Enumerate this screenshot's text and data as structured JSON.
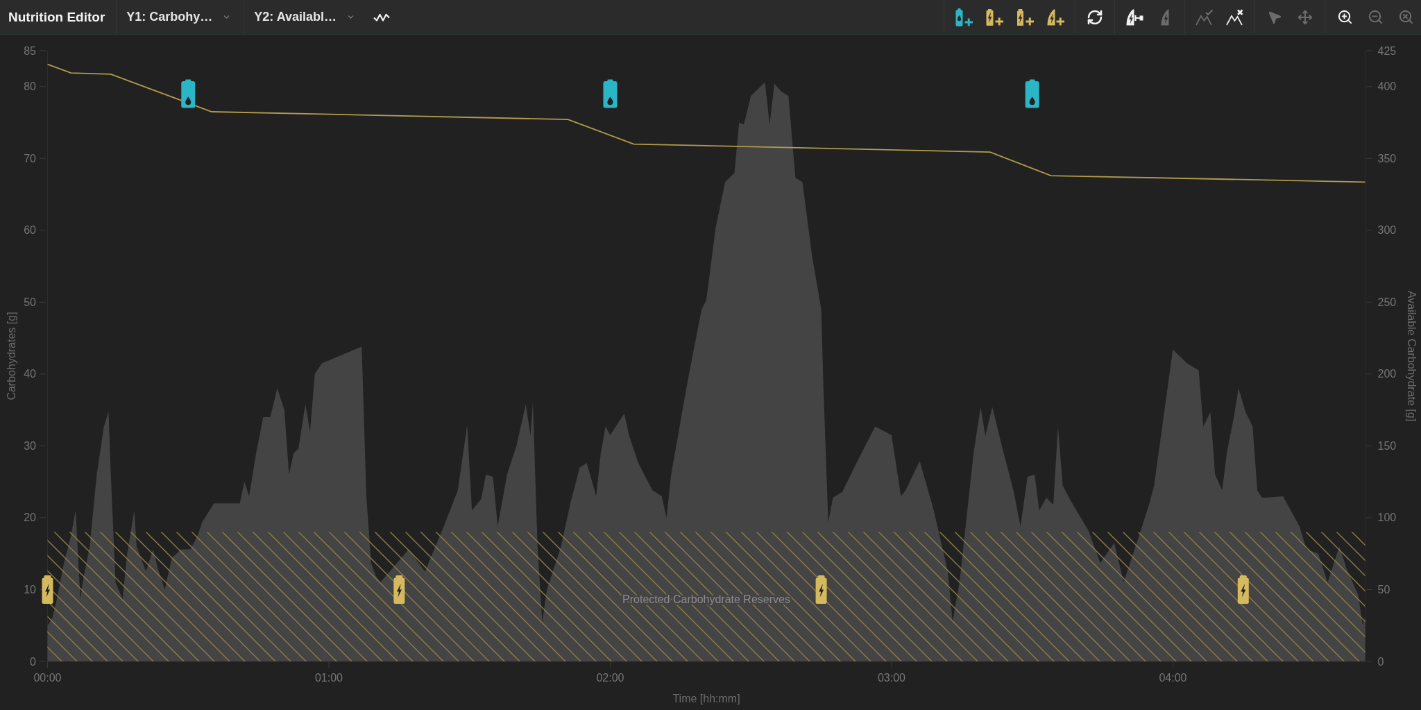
{
  "toolbar": {
    "title": "Nutrition Editor",
    "axis_dropdowns": [
      {
        "label": "Y1: Carbohy…"
      },
      {
        "label": "Y2: Availabl…"
      }
    ],
    "view_tools": [
      {
        "kind": "zigzag",
        "disabled": false
      }
    ],
    "tool_groups": [
      {
        "tools": [
          {
            "kind": "bottle-add",
            "disabled": false
          },
          {
            "kind": "battery-add",
            "disabled": false
          },
          {
            "kind": "pack-add",
            "disabled": false
          },
          {
            "kind": "wedge-add",
            "disabled": false
          }
        ]
      },
      {
        "tools": [
          {
            "kind": "refresh",
            "disabled": false
          }
        ]
      },
      {
        "tools": [
          {
            "kind": "wedge-range",
            "disabled": false
          },
          {
            "kind": "wedge",
            "disabled": true
          }
        ]
      },
      {
        "tools": [
          {
            "kind": "peaks-check",
            "disabled": true
          },
          {
            "kind": "peaks-x",
            "disabled": false
          }
        ]
      },
      {
        "tools": [
          {
            "kind": "pointer",
            "disabled": true
          },
          {
            "kind": "move",
            "disabled": true
          }
        ]
      },
      {
        "tools": [
          {
            "kind": "zoom-in",
            "disabled": false
          },
          {
            "kind": "zoom-out",
            "disabled": true
          },
          {
            "kind": "zoom-reset",
            "disabled": true
          }
        ]
      }
    ]
  },
  "chart": {
    "point_glyphs": [
      {
        "droplet": true
      },
      {
        "droplet": false
      }
    ],
    "chart_data": {
      "type": "area",
      "xlabel": "Time [hh:mm]",
      "ylabel": "Carbohydrates [g]",
      "y2label": "Available Carbohydrate [g]",
      "xlim": [
        0,
        281
      ],
      "ylim": [
        0,
        85
      ],
      "y2lim": [
        0,
        425
      ],
      "xticks": [
        {
          "value": 0,
          "label": "00:00"
        },
        {
          "value": 60,
          "label": "01:00"
        },
        {
          "value": 120,
          "label": "02:00"
        },
        {
          "value": 180,
          "label": "03:00"
        },
        {
          "value": 240,
          "label": "04:00"
        }
      ],
      "yticks": [
        0,
        10,
        20,
        30,
        40,
        50,
        60,
        70,
        80,
        85
      ],
      "y2ticks": [
        0,
        50,
        100,
        150,
        200,
        250,
        300,
        350,
        400,
        425
      ],
      "series": [
        {
          "color": "#444444",
          "x": [
            0,
            1,
            2,
            3.5,
            5,
            6,
            7,
            7.5,
            9,
            10.5,
            12,
            13,
            13.5,
            14.5,
            16,
            17,
            18.5,
            19,
            21,
            22.5,
            23.5,
            25,
            26.5,
            28.5,
            30.5,
            32,
            33,
            35.5,
            41,
            42,
            43,
            44.5,
            46,
            47.5,
            49,
            50.5,
            51.5,
            52.5,
            53.5,
            55,
            56,
            57,
            58.5,
            67,
            68,
            69,
            70,
            71,
            73,
            75,
            77,
            80.5,
            84.5,
            87.5,
            89.5,
            90.5,
            92.5,
            93.5,
            95,
            96,
            98,
            100,
            102,
            103,
            103.5,
            104.5,
            105.5,
            106.5,
            109.5,
            111.5,
            113.5,
            115,
            117,
            118,
            119,
            120,
            123,
            124,
            126,
            129,
            131,
            132,
            133,
            136.5,
            139.5,
            140.5,
            142.5,
            144.5,
            146.5,
            147.5,
            148.5,
            150,
            153,
            154,
            155,
            156.5,
            158,
            159.5,
            161,
            163,
            165,
            165.5,
            166.5,
            167.5,
            169.5,
            172.5,
            176.5,
            180,
            182,
            183,
            186,
            189,
            192,
            193,
            194.5,
            197.5,
            199,
            200,
            201.5,
            203.5,
            206,
            207.5,
            209,
            210.5,
            211.5,
            213,
            214.5,
            215.5,
            216.5,
            218,
            222,
            224.5,
            227.5,
            229.5,
            232.5,
            235,
            236,
            238,
            240,
            243,
            245.5,
            246.5,
            248,
            249,
            250.5,
            251.5,
            253,
            254,
            255.5,
            257,
            258,
            259,
            260,
            263.5,
            267,
            268.5,
            271,
            273,
            275.5,
            277,
            279,
            279.5,
            280.5,
            281
          ],
          "values": [
            5,
            6,
            8.7,
            13.7,
            17.5,
            21,
            8.7,
            11,
            16,
            26,
            32.6,
            34.8,
            26,
            11,
            8.7,
            15,
            21,
            16,
            12.5,
            15.6,
            13,
            10,
            14.4,
            15.6,
            15.6,
            17.5,
            19.4,
            22,
            22,
            25,
            23,
            29,
            34,
            34,
            38,
            35,
            26,
            29,
            29.6,
            35.8,
            32,
            40,
            41.5,
            43.8,
            23,
            13.7,
            11.9,
            11,
            12.5,
            null,
            15.6,
            12.5,
            18.8,
            23.8,
            32.9,
            21,
            22.6,
            26,
            25.7,
            18.8,
            26,
            30,
            35.8,
            31.4,
            36,
            16,
            5.5,
            10,
            16,
            22,
            27,
            27.6,
            23,
            29,
            32.7,
            31.5,
            34.5,
            31.5,
            27.6,
            23.8,
            23,
            20,
            26,
            39,
            49,
            50.3,
            60.4,
            66.7,
            68,
            75,
            74.7,
            78.7,
            80.6,
            74.7,
            80.4,
            79.3,
            78.7,
            67.3,
            66.7,
            56.6,
            49,
            37.7,
            19.4,
            22.8,
            23.6,
            27.6,
            32.7,
            31.5,
            23,
            23.8,
            27.9,
            21,
            12.5,
            5.5,
            11,
            29,
            35.4,
            31.4,
            35.4,
            30,
            23.8,
            18.8,
            25.7,
            26,
            21,
            22.8,
            21.8,
            32.7,
            24.5,
            22.6,
            18.2,
            13.7,
            16.5,
            11,
            16.9,
            22,
            24.5,
            34,
            43.4,
            41.5,
            40.5,
            32.7,
            34.7,
            26,
            23.8,
            29,
            34,
            38,
            34.7,
            32.7,
            23.8,
            22.8,
            22.8,
            23,
            18.8,
            15.6,
            15,
            11,
            16,
            13,
            10,
            9.3,
            5,
            6.2
          ]
        },
        {
          "type": "line",
          "axis": "y2",
          "color": "#b39a4c",
          "x": [
            0,
            5,
            13.5,
            35,
            111,
            125,
            201,
            214,
            281
          ],
          "values": [
            415.5,
            409.5,
            408.7,
            382.5,
            377.1,
            360,
            354.4,
            338,
            333.6
          ]
        },
        {
          "type": "scatter",
          "color": "#2ab6c6",
          "x": [
            30,
            120,
            210
          ],
          "values": [
            79,
            79,
            79
          ]
        },
        {
          "type": "scatter",
          "color": "#d5b95f",
          "x": [
            0,
            75,
            165,
            255
          ],
          "values": [
            10,
            10,
            10,
            10
          ]
        }
      ],
      "bands": [
        {
          "axis": "y",
          "from": 0,
          "to": 18,
          "label": "Protected Carbohydrate Reserves"
        }
      ]
    }
  }
}
